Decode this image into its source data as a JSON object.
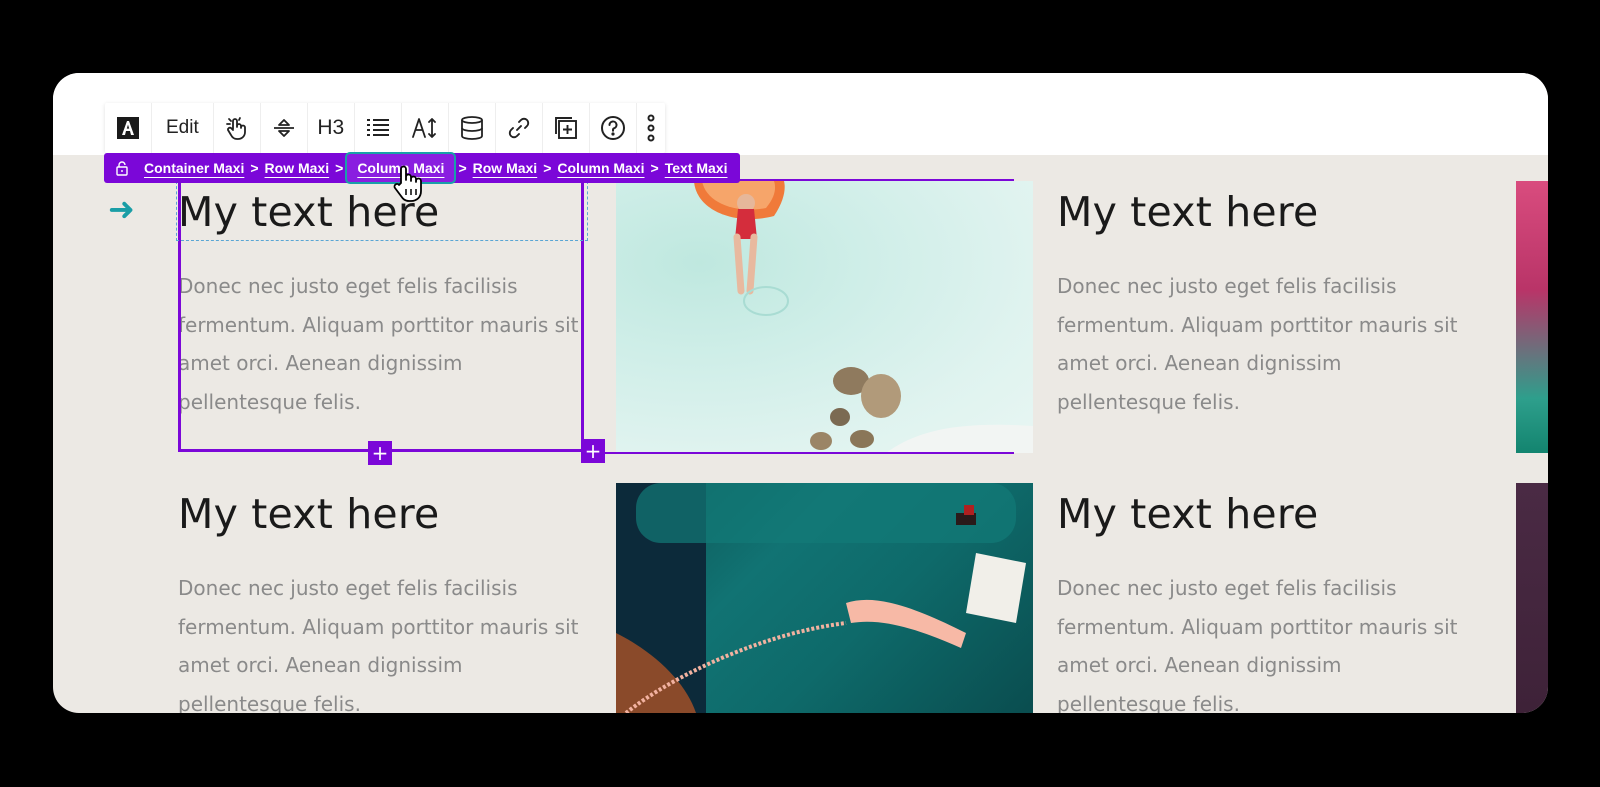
{
  "toolbar": {
    "edit_label": "Edit",
    "heading_label": "H3",
    "icons": [
      "font-style-icon",
      "hand-pointer-icon",
      "alignment-icon",
      "heading-icon",
      "list-icon",
      "text-size-icon",
      "database-icon",
      "link-icon",
      "add-block-icon",
      "help-icon",
      "more-vertical-icon"
    ]
  },
  "breadcrumb": {
    "items": [
      "Container Maxi",
      "Row Maxi",
      "Column Maxi",
      "Row Maxi",
      "Column Maxi",
      "Text Maxi"
    ],
    "separator": ">",
    "highlighted_index": 2
  },
  "blocks": [
    {
      "heading": "My text here",
      "body": "Donec nec justo eget felis facilisis fermentum. Aliquam porttitor mauris sit amet orci. Aenean dignissim pellentesque felis."
    },
    {
      "heading": "My text here",
      "body": "Donec nec justo eget felis facilisis fermentum. Aliquam porttitor mauris sit amet orci. Aenean dignissim pellentesque felis."
    },
    {
      "heading": "My text here",
      "body": "Donec nec justo eget felis facilisis fermentum. Aliquam porttitor mauris sit amet orci. Aenean dignissim pellentesque felis."
    },
    {
      "heading": "My text here",
      "body": "Donec nec justo eget felis facilisis fermentum. Aliquam porttitor mauris sit amet orci. Aenean dignissim pellentesque felis."
    }
  ],
  "controls": {
    "plus": "+",
    "arrow": "➜"
  },
  "colors": {
    "accent": "#7b07d8",
    "highlight": "#19a0a8",
    "background": "#ece9e4"
  }
}
